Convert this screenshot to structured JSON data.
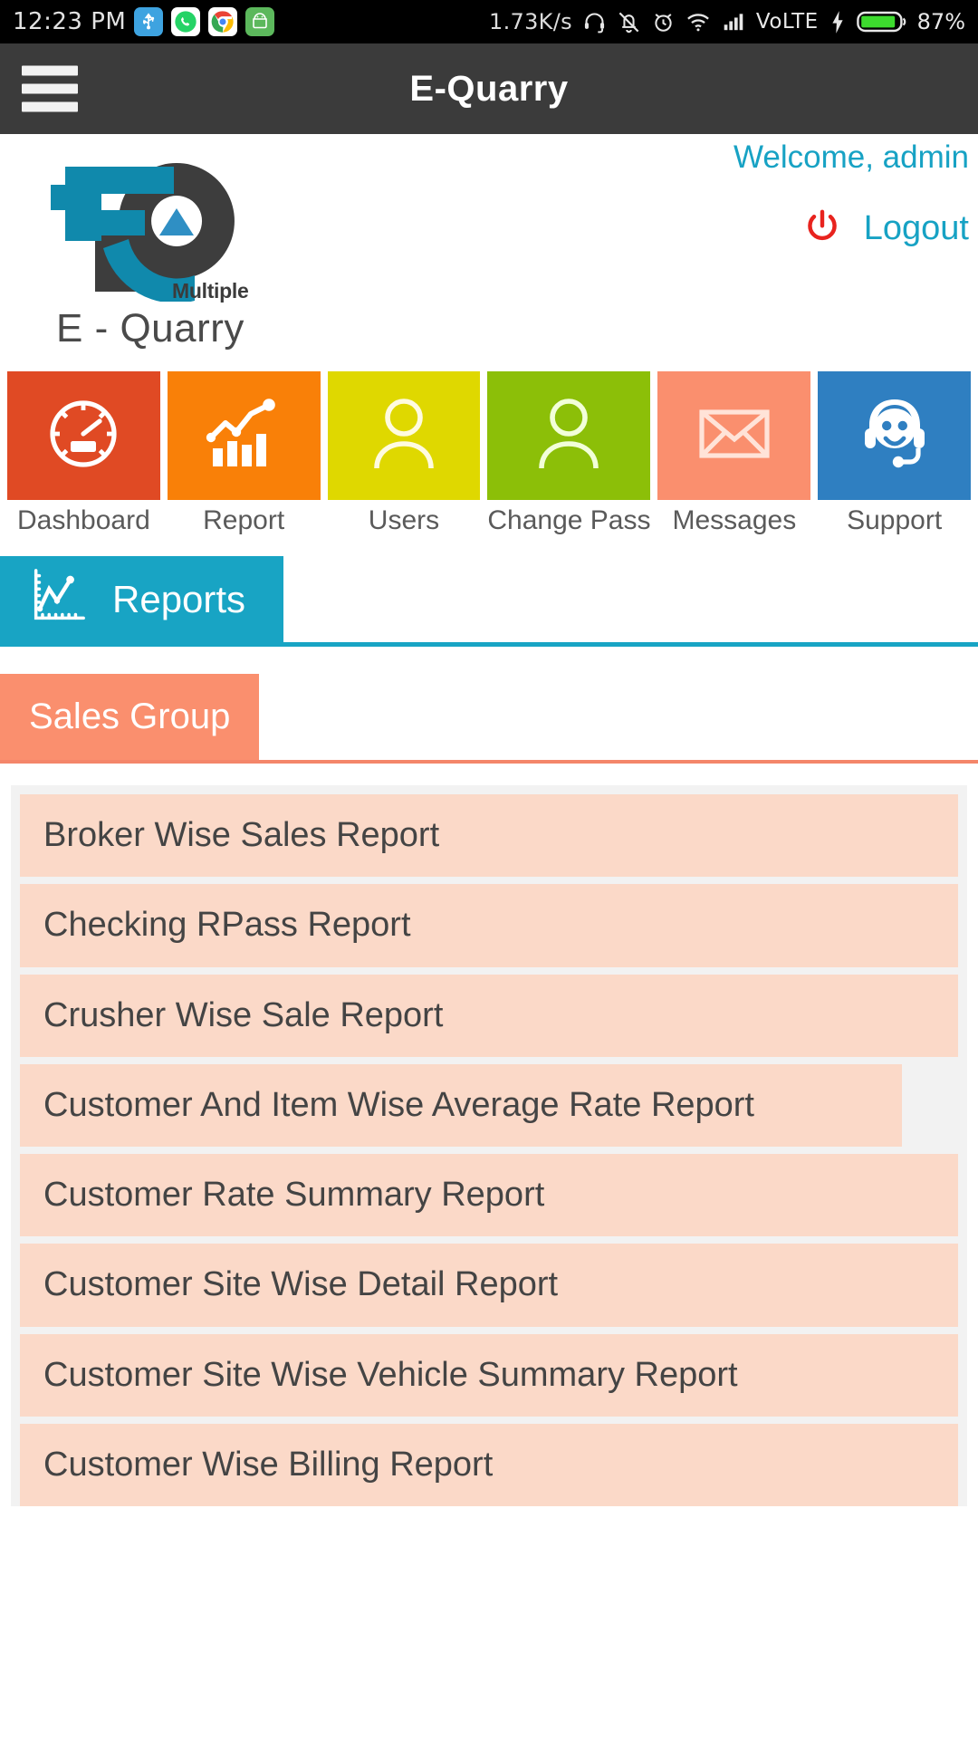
{
  "status_bar": {
    "time": "12:23 PM",
    "app_icons": [
      {
        "name": "usb-icon",
        "glyph": "Ψ"
      },
      {
        "name": "whatsapp-icon",
        "glyph": ""
      },
      {
        "name": "chrome-icon",
        "glyph": ""
      },
      {
        "name": "android-icon",
        "glyph": ""
      }
    ],
    "network_speed": "1.73K/s",
    "network_type": "VoLTE",
    "battery_percent": "87%",
    "icons": [
      "headset-icon",
      "mute-vibrate-icon",
      "alarm-icon",
      "wifi-icon",
      "signal-icon",
      "charging-bolt-icon",
      "battery-icon"
    ]
  },
  "header": {
    "title": "E-Quarry",
    "menu_icon": "hamburger-icon"
  },
  "account": {
    "welcome": "Welcome, admin",
    "logout_label": "Logout",
    "logout_icon": "power-icon"
  },
  "logo": {
    "superscript": "Multiple",
    "wordmark": "E - Quarry"
  },
  "nav_tiles": [
    {
      "label": "Dashboard",
      "icon": "speedometer-icon",
      "color": "#e04a24"
    },
    {
      "label": "Report",
      "icon": "bar-chart-icon",
      "color": "#f98008"
    },
    {
      "label": "Users",
      "icon": "person-icon",
      "color": "#dfd800"
    },
    {
      "label": "Change Pass",
      "icon": "person-icon",
      "color": "#8cbf08"
    },
    {
      "label": "Messages",
      "icon": "envelope-icon",
      "color": "#fa8f6e"
    },
    {
      "label": "Support",
      "icon": "headset-support-icon",
      "color": "#2f7fc1"
    }
  ],
  "reports_tab": {
    "label": "Reports",
    "icon": "line-chart-icon",
    "color": "#18a4c4"
  },
  "group_tabs": [
    {
      "label": "Sales Group",
      "active": true,
      "color": "#fa8f6e"
    }
  ],
  "report_list": [
    {
      "title": "Broker Wise Sales Report"
    },
    {
      "title": "Checking RPass Report"
    },
    {
      "title": "Crusher Wise Sale Report"
    },
    {
      "title": "Customer And Item Wise Average Rate Report"
    },
    {
      "title": "Customer Rate Summary Report"
    },
    {
      "title": "Customer Site Wise Detail Report"
    },
    {
      "title": "Customer Site Wise Vehicle Summary Report"
    },
    {
      "title": "Customer Wise Billing Report"
    }
  ],
  "colors": {
    "accent_teal": "#18a4c4",
    "accent_salmon": "#fa8f6e",
    "list_item_bg": "#fbd9c8",
    "header_bg": "#3b3b3b"
  }
}
